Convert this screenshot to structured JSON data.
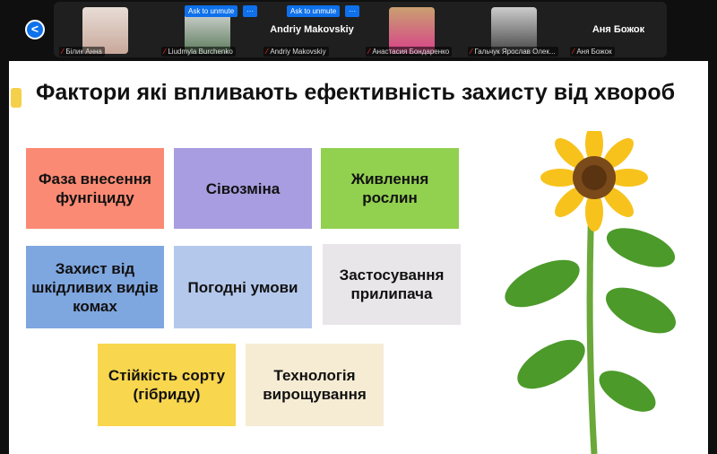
{
  "meeting": {
    "back_label": "<",
    "participants": [
      {
        "name": "Білик Анна",
        "muted": true
      },
      {
        "name": "Liudmyla Burchenko",
        "muted": true,
        "ask_to_unmute": "Ask to unmute",
        "more": "···"
      },
      {
        "name": "Andriy Makovskiy",
        "display": "Andriy Makovskiy",
        "muted": true,
        "ask_to_unmute": "Ask to unmute",
        "more": "···"
      },
      {
        "name": "Анастасия Бондаренко",
        "muted": true
      },
      {
        "name": "Гальчук Ярослав Олек...",
        "muted": true
      },
      {
        "name": "Аня Божок",
        "display": "Аня Божок",
        "muted": true
      }
    ]
  },
  "slide": {
    "title": "Фактори які впливають ефективність захисту від хвороб",
    "boxes": [
      {
        "text": "Фаза внесення фунгіциду",
        "color": "#fb8a74"
      },
      {
        "text": "Сівозміна",
        "color": "#a89de0"
      },
      {
        "text": "Живлення рослин",
        "color": "#92d050"
      },
      {
        "text": "Захист від шкідливих видів комах",
        "color": "#7ea6df"
      },
      {
        "text": "Погодні умови",
        "color": "#b4c8ec"
      },
      {
        "text": "Застосування прилипача",
        "color": "#e8e6e8"
      },
      {
        "text": "Стійкість сорту (гібриду)",
        "color": "#f8d64e"
      },
      {
        "text": "Технологія вирощування",
        "color": "#f6ecd4"
      }
    ]
  }
}
